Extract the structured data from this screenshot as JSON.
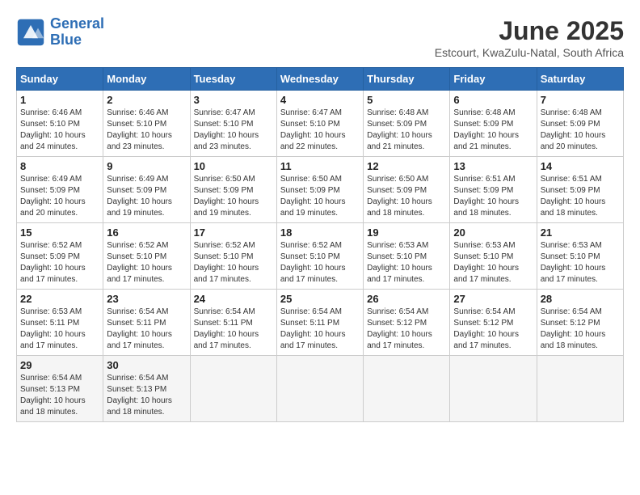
{
  "logo": {
    "line1": "General",
    "line2": "Blue"
  },
  "title": "June 2025",
  "location": "Estcourt, KwaZulu-Natal, South Africa",
  "headers": [
    "Sunday",
    "Monday",
    "Tuesday",
    "Wednesday",
    "Thursday",
    "Friday",
    "Saturday"
  ],
  "weeks": [
    [
      {
        "day": "1",
        "sunrise": "6:46 AM",
        "sunset": "5:10 PM",
        "daylight": "10 hours and 24 minutes."
      },
      {
        "day": "2",
        "sunrise": "6:46 AM",
        "sunset": "5:10 PM",
        "daylight": "10 hours and 23 minutes."
      },
      {
        "day": "3",
        "sunrise": "6:47 AM",
        "sunset": "5:10 PM",
        "daylight": "10 hours and 23 minutes."
      },
      {
        "day": "4",
        "sunrise": "6:47 AM",
        "sunset": "5:10 PM",
        "daylight": "10 hours and 22 minutes."
      },
      {
        "day": "5",
        "sunrise": "6:48 AM",
        "sunset": "5:09 PM",
        "daylight": "10 hours and 21 minutes."
      },
      {
        "day": "6",
        "sunrise": "6:48 AM",
        "sunset": "5:09 PM",
        "daylight": "10 hours and 21 minutes."
      },
      {
        "day": "7",
        "sunrise": "6:48 AM",
        "sunset": "5:09 PM",
        "daylight": "10 hours and 20 minutes."
      }
    ],
    [
      {
        "day": "8",
        "sunrise": "6:49 AM",
        "sunset": "5:09 PM",
        "daylight": "10 hours and 20 minutes."
      },
      {
        "day": "9",
        "sunrise": "6:49 AM",
        "sunset": "5:09 PM",
        "daylight": "10 hours and 19 minutes."
      },
      {
        "day": "10",
        "sunrise": "6:50 AM",
        "sunset": "5:09 PM",
        "daylight": "10 hours and 19 minutes."
      },
      {
        "day": "11",
        "sunrise": "6:50 AM",
        "sunset": "5:09 PM",
        "daylight": "10 hours and 19 minutes."
      },
      {
        "day": "12",
        "sunrise": "6:50 AM",
        "sunset": "5:09 PM",
        "daylight": "10 hours and 18 minutes."
      },
      {
        "day": "13",
        "sunrise": "6:51 AM",
        "sunset": "5:09 PM",
        "daylight": "10 hours and 18 minutes."
      },
      {
        "day": "14",
        "sunrise": "6:51 AM",
        "sunset": "5:09 PM",
        "daylight": "10 hours and 18 minutes."
      }
    ],
    [
      {
        "day": "15",
        "sunrise": "6:52 AM",
        "sunset": "5:09 PM",
        "daylight": "10 hours and 17 minutes."
      },
      {
        "day": "16",
        "sunrise": "6:52 AM",
        "sunset": "5:10 PM",
        "daylight": "10 hours and 17 minutes."
      },
      {
        "day": "17",
        "sunrise": "6:52 AM",
        "sunset": "5:10 PM",
        "daylight": "10 hours and 17 minutes."
      },
      {
        "day": "18",
        "sunrise": "6:52 AM",
        "sunset": "5:10 PM",
        "daylight": "10 hours and 17 minutes."
      },
      {
        "day": "19",
        "sunrise": "6:53 AM",
        "sunset": "5:10 PM",
        "daylight": "10 hours and 17 minutes."
      },
      {
        "day": "20",
        "sunrise": "6:53 AM",
        "sunset": "5:10 PM",
        "daylight": "10 hours and 17 minutes."
      },
      {
        "day": "21",
        "sunrise": "6:53 AM",
        "sunset": "5:10 PM",
        "daylight": "10 hours and 17 minutes."
      }
    ],
    [
      {
        "day": "22",
        "sunrise": "6:53 AM",
        "sunset": "5:11 PM",
        "daylight": "10 hours and 17 minutes."
      },
      {
        "day": "23",
        "sunrise": "6:54 AM",
        "sunset": "5:11 PM",
        "daylight": "10 hours and 17 minutes."
      },
      {
        "day": "24",
        "sunrise": "6:54 AM",
        "sunset": "5:11 PM",
        "daylight": "10 hours and 17 minutes."
      },
      {
        "day": "25",
        "sunrise": "6:54 AM",
        "sunset": "5:11 PM",
        "daylight": "10 hours and 17 minutes."
      },
      {
        "day": "26",
        "sunrise": "6:54 AM",
        "sunset": "5:12 PM",
        "daylight": "10 hours and 17 minutes."
      },
      {
        "day": "27",
        "sunrise": "6:54 AM",
        "sunset": "5:12 PM",
        "daylight": "10 hours and 17 minutes."
      },
      {
        "day": "28",
        "sunrise": "6:54 AM",
        "sunset": "5:12 PM",
        "daylight": "10 hours and 18 minutes."
      }
    ],
    [
      {
        "day": "29",
        "sunrise": "6:54 AM",
        "sunset": "5:13 PM",
        "daylight": "10 hours and 18 minutes."
      },
      {
        "day": "30",
        "sunrise": "6:54 AM",
        "sunset": "5:13 PM",
        "daylight": "10 hours and 18 minutes."
      },
      null,
      null,
      null,
      null,
      null
    ]
  ]
}
